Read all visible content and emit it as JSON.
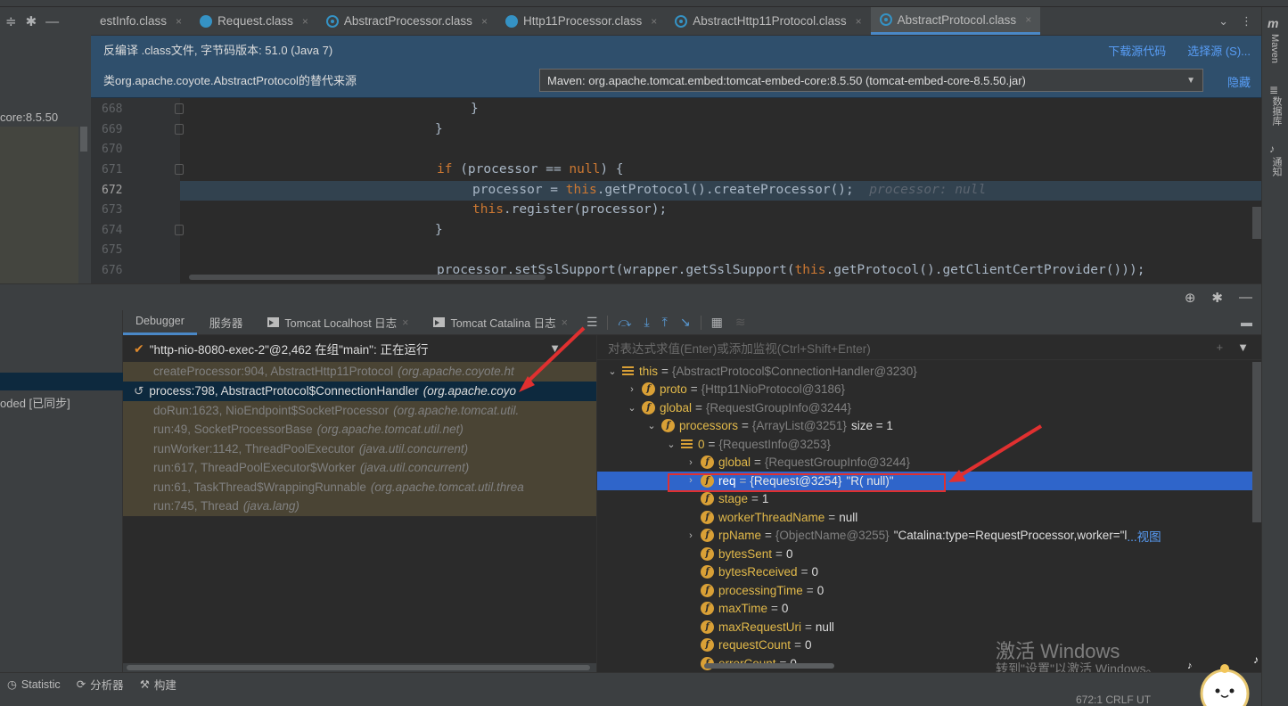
{
  "tabs": [
    {
      "label": "estInfo.class",
      "icon": "none",
      "closable": true
    },
    {
      "label": "Request.class",
      "icon": "class-icon",
      "closable": true
    },
    {
      "label": "AbstractProcessor.class",
      "icon": "abstract-class-icon",
      "closable": true
    },
    {
      "label": "Http11Processor.class",
      "icon": "class-icon",
      "closable": true
    },
    {
      "label": "AbstractHttp11Protocol.class",
      "icon": "abstract-class-icon",
      "closable": true
    },
    {
      "label": "AbstractProtocol.class",
      "icon": "abstract-class-icon",
      "closable": true,
      "active": true
    }
  ],
  "banner": {
    "decompiled": "反编译 .class文件, 字节码版本: 51.0 (Java 7)",
    "download_source": "下载源代码",
    "choose_source": "选择源 (S)...",
    "alt_source": "类org.apache.coyote.AbstractProtocol的替代来源",
    "maven_selection": "Maven: org.apache.tomcat.embed:tomcat-embed-core:8.5.50 (tomcat-embed-core-8.5.50.jar)",
    "hide": "隐藏"
  },
  "left_panel": {
    "tree_item": "core:8.5.50"
  },
  "right_strip": {
    "maven": "Maven",
    "database": "数据库",
    "notifications": "通知"
  },
  "editor": {
    "current_line": 672,
    "lines": [
      {
        "num": "668",
        "code": "}"
      },
      {
        "num": "669",
        "code": "}"
      },
      {
        "num": "670",
        "code": ""
      },
      {
        "num": "671",
        "code_kw": "if",
        "code_rest": " (processor == ",
        "code_kw2": "null",
        "code_end": ") {"
      },
      {
        "num": "672",
        "code_a": "processor = ",
        "code_kw": "this",
        "code_b": ".getProtocol().createProcessor();",
        "hint": "processor: null"
      },
      {
        "num": "673",
        "code_kw": "this",
        "code_b": ".register(processor);"
      },
      {
        "num": "674",
        "code": "}"
      },
      {
        "num": "675",
        "code": ""
      },
      {
        "num": "676",
        "code_a": "processor.setSslSupport(wrapper.getSslSupport(",
        "code_kw": "this",
        "code_b": ".getProtocol().getClientCertProvider()));"
      }
    ]
  },
  "debugger": {
    "tabs": [
      "Debugger",
      "服务器",
      "Tomcat Localhost 日志",
      "Tomcat Catalina 日志"
    ],
    "left_item": "oded [已同步]",
    "thread": "\"http-nio-8080-exec-2\"@2,462 在组\"main\": 正在运行",
    "frames": [
      {
        "method": "createProcessor:904, AbstractHttp11Protocol",
        "pkg": "(org.apache.coyote.ht"
      },
      {
        "method": "process:798, AbstractProtocol$ConnectionHandler",
        "pkg": "(org.apache.coyo",
        "selected": true
      },
      {
        "method": "doRun:1623, NioEndpoint$SocketProcessor",
        "pkg": "(org.apache.tomcat.util."
      },
      {
        "method": "run:49, SocketProcessorBase",
        "pkg": "(org.apache.tomcat.util.net)"
      },
      {
        "method": "runWorker:1142, ThreadPoolExecutor",
        "pkg": "(java.util.concurrent)"
      },
      {
        "method": "run:617, ThreadPoolExecutor$Worker",
        "pkg": "(java.util.concurrent)"
      },
      {
        "method": "run:61, TaskThread$WrappingRunnable",
        "pkg": "(org.apache.tomcat.util.threa"
      },
      {
        "method": "run:745, Thread",
        "pkg": "(java.lang)"
      }
    ],
    "watch_placeholder": "对表达式求值(Enter)或添加监视(Ctrl+Shift+Enter)",
    "variables": [
      {
        "name": "this",
        "eq": "=",
        "val": "{AbstractProtocol$ConnectionHandler@3230}",
        "expanded": true,
        "depth": 0,
        "icon": "list"
      },
      {
        "name": "proto",
        "eq": "=",
        "val": "{Http11NioProtocol@3186}",
        "expanded": false,
        "depth": 1,
        "icon": "field"
      },
      {
        "name": "global",
        "eq": "=",
        "val": "{RequestGroupInfo@3244}",
        "expanded": true,
        "depth": 1,
        "icon": "field"
      },
      {
        "name": "processors",
        "eq": "=",
        "val": "{ArrayList@3251}",
        "extra": "size = 1",
        "expanded": true,
        "depth": 2,
        "icon": "field"
      },
      {
        "name": "0",
        "eq": "=",
        "val": "{RequestInfo@3253}",
        "expanded": true,
        "depth": 3,
        "icon": "list"
      },
      {
        "name": "global",
        "eq": "=",
        "val": "{RequestGroupInfo@3244}",
        "expanded": false,
        "depth": 4,
        "icon": "field"
      },
      {
        "name": "req",
        "eq": "=",
        "val": "{Request@3254}",
        "extra": "\"R( null)\"",
        "expanded": false,
        "depth": 4,
        "icon": "field",
        "selected": true
      },
      {
        "name": "stage",
        "eq": "=",
        "val": "1",
        "depth": 4,
        "icon": "field",
        "prim": true
      },
      {
        "name": "workerThreadName",
        "eq": "=",
        "val": "null",
        "depth": 4,
        "icon": "field",
        "prim": true
      },
      {
        "name": "rpName",
        "eq": "=",
        "val": "{ObjectName@3255}",
        "extra": "\"Catalina:type=RequestProcessor,worker=\"l",
        "link": "...视图",
        "expanded": false,
        "depth": 4,
        "icon": "field"
      },
      {
        "name": "bytesSent",
        "eq": "=",
        "val": "0",
        "depth": 4,
        "icon": "field",
        "prim": true
      },
      {
        "name": "bytesReceived",
        "eq": "=",
        "val": "0",
        "depth": 4,
        "icon": "field",
        "prim": true
      },
      {
        "name": "processingTime",
        "eq": "=",
        "val": "0",
        "depth": 4,
        "icon": "field",
        "prim": true
      },
      {
        "name": "maxTime",
        "eq": "=",
        "val": "0",
        "depth": 4,
        "icon": "field",
        "prim": true
      },
      {
        "name": "maxRequestUri",
        "eq": "=",
        "val": "null",
        "depth": 4,
        "icon": "field",
        "prim": true
      },
      {
        "name": "requestCount",
        "eq": "=",
        "val": "0",
        "depth": 4,
        "icon": "field",
        "prim": true
      },
      {
        "name": "errorCount",
        "eq": "=",
        "val": "0",
        "depth": 4,
        "icon": "field",
        "prim": true
      }
    ]
  },
  "bottom": {
    "statistic": "Statistic",
    "profiler": "分析器",
    "build": "构建",
    "position": "672:1  CRLF  UT"
  },
  "watermark": {
    "line1": "激活 Windows",
    "line2": "转到\"设置\"以激活 Windows。"
  },
  "colors": {
    "accent": "#4a88c7",
    "selection": "#2f65ca",
    "annotation": "#e03030",
    "field_icon": "#d9a036"
  }
}
